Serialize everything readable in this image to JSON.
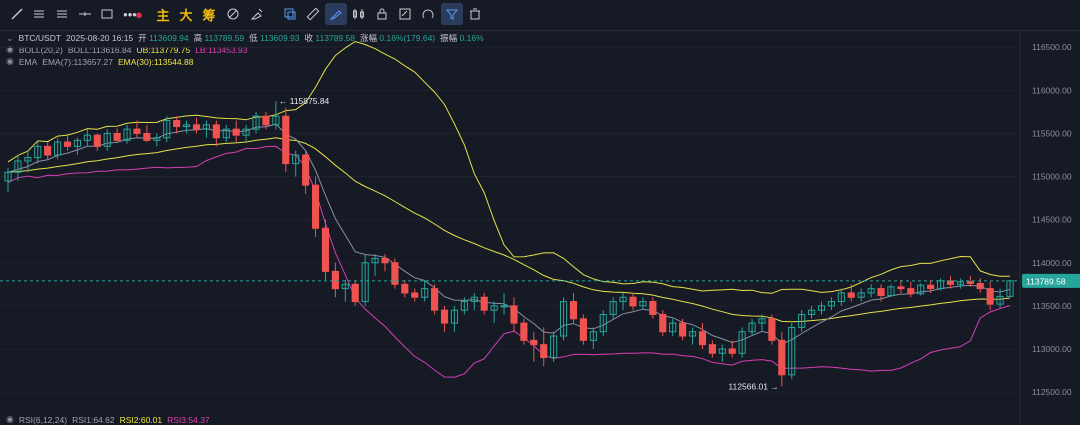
{
  "colors": {
    "up": "#26a69a",
    "down": "#ef5350",
    "ema7": "#8a90a6",
    "ema30": "#e6e04a",
    "boll_upper": "#e6e04a",
    "boll_lower": "#d63fb3",
    "bg": "#161a25",
    "last": "#26a69a"
  },
  "toolbar": {
    "icons": [
      "trend-line-icon",
      "horizontal-lines-icon",
      "parallel-lines-icon",
      "cross-line-icon",
      "rectangle-icon",
      "more-dots-icon",
      "red-dot-icon"
    ],
    "cn_labels": [
      "主",
      "大",
      "筹"
    ],
    "right_icons": [
      "layout-icon",
      "clear-icon",
      "copy-shape-icon",
      "ruler-icon",
      "draw-mode-icon",
      "indicator-icon",
      "note-icon",
      "lock-icon",
      "magnet-icon",
      "filter-icon",
      "trash-icon"
    ]
  },
  "legend": {
    "pair": "BTC/USDT",
    "datetime": "2025-08-20 16:15",
    "open_label": "开",
    "open_val": "113609.94",
    "high_label": "高",
    "high_val": "113789.59",
    "low_label": "低",
    "low_val": "113609.93",
    "close_label": "收",
    "close_val": "113789.58",
    "change_label": "涨幅",
    "change_val": "0.16%(179.64)",
    "amp_label": "振幅",
    "amp_val": "0.16%",
    "boll_name": "BOLL(20,2)",
    "boll_val": "BOLL:113616.84",
    "ub_val": "UB:113779.75",
    "lb_val": "LB:113453.93",
    "ema_name": "EMA",
    "ema7_val": "EMA(7):113657.27",
    "ema30_val": "EMA(30):113544.88",
    "rsi_name": "RSI(6,12,24)",
    "rsi1_val": "RSI1:64.62",
    "rsi2_val": "RSI2:60.01",
    "rsi3_val": "RSI3:54.37"
  },
  "chart_data": {
    "type": "candlestick",
    "ylim": [
      112350,
      116700
    ],
    "y_ticks": [
      "116500.00",
      "116000.00",
      "115500.00",
      "115000.00",
      "114500.00",
      "114000.00",
      "113500.00",
      "113000.00",
      "112500.00"
    ],
    "last_price": "113789.58",
    "high_annotation": "115875.84",
    "low_annotation": "112566.01",
    "candles": [
      [
        114950,
        115100,
        114820,
        115050
      ],
      [
        115050,
        115250,
        114950,
        115180
      ],
      [
        115180,
        115300,
        115050,
        115220
      ],
      [
        115220,
        115400,
        115150,
        115350
      ],
      [
        115350,
        115400,
        115200,
        115250
      ],
      [
        115250,
        115450,
        115200,
        115400
      ],
      [
        115400,
        115500,
        115300,
        115350
      ],
      [
        115350,
        115450,
        115250,
        115420
      ],
      [
        115420,
        115550,
        115350,
        115480
      ],
      [
        115480,
        115500,
        115300,
        115350
      ],
      [
        115350,
        115550,
        115300,
        115500
      ],
      [
        115500,
        115560,
        115400,
        115420
      ],
      [
        115420,
        115600,
        115380,
        115550
      ],
      [
        115550,
        115650,
        115450,
        115500
      ],
      [
        115500,
        115600,
        115400,
        115420
      ],
      [
        115420,
        115500,
        115350,
        115450
      ],
      [
        115450,
        115700,
        115400,
        115650
      ],
      [
        115650,
        115700,
        115500,
        115580
      ],
      [
        115580,
        115650,
        115500,
        115600
      ],
      [
        115600,
        115680,
        115500,
        115550
      ],
      [
        115550,
        115650,
        115450,
        115600
      ],
      [
        115600,
        115650,
        115350,
        115450
      ],
      [
        115450,
        115600,
        115400,
        115550
      ],
      [
        115550,
        115650,
        115400,
        115480
      ],
      [
        115480,
        115600,
        115400,
        115550
      ],
      [
        115550,
        115750,
        115500,
        115700
      ],
      [
        115700,
        115750,
        115550,
        115600
      ],
      [
        115600,
        115876,
        115550,
        115700
      ],
      [
        115700,
        115800,
        115050,
        115150
      ],
      [
        115150,
        115300,
        115000,
        115250
      ],
      [
        115250,
        115300,
        114800,
        114900
      ],
      [
        114900,
        115000,
        114300,
        114400
      ],
      [
        114400,
        114500,
        113800,
        113900
      ],
      [
        113900,
        114000,
        113600,
        113700
      ],
      [
        113700,
        113800,
        113550,
        113750
      ],
      [
        113750,
        113800,
        113500,
        113550
      ],
      [
        113550,
        114100,
        113500,
        114000
      ],
      [
        114000,
        114100,
        113850,
        114050
      ],
      [
        114050,
        114100,
        113900,
        114000
      ],
      [
        114000,
        114050,
        113700,
        113750
      ],
      [
        113750,
        113800,
        113600,
        113650
      ],
      [
        113650,
        113700,
        113550,
        113600
      ],
      [
        113600,
        113800,
        113550,
        113700
      ],
      [
        113700,
        113750,
        113400,
        113450
      ],
      [
        113450,
        113500,
        113200,
        113300
      ],
      [
        113300,
        113500,
        113200,
        113450
      ],
      [
        113450,
        113600,
        113400,
        113550
      ],
      [
        113550,
        113650,
        113450,
        113600
      ],
      [
        113600,
        113650,
        113400,
        113450
      ],
      [
        113450,
        113550,
        113300,
        113500
      ],
      [
        113500,
        113650,
        113400,
        113500
      ],
      [
        113500,
        113600,
        113200,
        113300
      ],
      [
        113300,
        113350,
        113050,
        113100
      ],
      [
        113100,
        113200,
        112850,
        113050
      ],
      [
        113050,
        113250,
        112800,
        112900
      ],
      [
        112900,
        113200,
        112850,
        113150
      ],
      [
        113150,
        113600,
        113100,
        113550
      ],
      [
        113550,
        113650,
        113300,
        113350
      ],
      [
        113350,
        113400,
        113050,
        113100
      ],
      [
        113100,
        113250,
        113000,
        113200
      ],
      [
        113200,
        113450,
        113150,
        113400
      ],
      [
        113400,
        113600,
        113350,
        113550
      ],
      [
        113550,
        113650,
        113450,
        113600
      ],
      [
        113600,
        113650,
        113450,
        113500
      ],
      [
        113500,
        113600,
        113450,
        113550
      ],
      [
        113550,
        113600,
        113350,
        113400
      ],
      [
        113400,
        113450,
        113150,
        113200
      ],
      [
        113200,
        113350,
        113150,
        113300
      ],
      [
        113300,
        113350,
        113100,
        113150
      ],
      [
        113150,
        113250,
        113050,
        113200
      ],
      [
        113200,
        113300,
        113000,
        113050
      ],
      [
        113050,
        113100,
        112900,
        112950
      ],
      [
        112950,
        113050,
        112850,
        113000
      ],
      [
        113000,
        113100,
        112900,
        112950
      ],
      [
        112950,
        113250,
        112900,
        113200
      ],
      [
        113200,
        113350,
        113150,
        113300
      ],
      [
        113300,
        113400,
        113200,
        113350
      ],
      [
        113350,
        113400,
        113050,
        113100
      ],
      [
        113100,
        113200,
        112566,
        112700
      ],
      [
        112700,
        113300,
        112650,
        113250
      ],
      [
        113250,
        113450,
        113200,
        113400
      ],
      [
        113400,
        113500,
        113350,
        113450
      ],
      [
        113450,
        113550,
        113400,
        113500
      ],
      [
        113500,
        113600,
        113450,
        113550
      ],
      [
        113550,
        113700,
        113500,
        113650
      ],
      [
        113650,
        113750,
        113550,
        113600
      ],
      [
        113600,
        113700,
        113550,
        113650
      ],
      [
        113650,
        113750,
        113600,
        113700
      ],
      [
        113700,
        113750,
        113550,
        113620
      ],
      [
        113620,
        113750,
        113600,
        113720
      ],
      [
        113720,
        113800,
        113650,
        113700
      ],
      [
        113700,
        113780,
        113600,
        113640
      ],
      [
        113640,
        113760,
        113620,
        113740
      ],
      [
        113740,
        113800,
        113650,
        113700
      ],
      [
        113700,
        113820,
        113680,
        113790
      ],
      [
        113790,
        113850,
        113700,
        113750
      ],
      [
        113750,
        113820,
        113700,
        113780
      ],
      [
        113780,
        113850,
        113720,
        113760
      ],
      [
        113760,
        113820,
        113650,
        113700
      ],
      [
        113700,
        113780,
        113450,
        113520
      ],
      [
        113520,
        113700,
        113480,
        113610
      ],
      [
        113610,
        113790,
        113610,
        113790
      ]
    ]
  }
}
